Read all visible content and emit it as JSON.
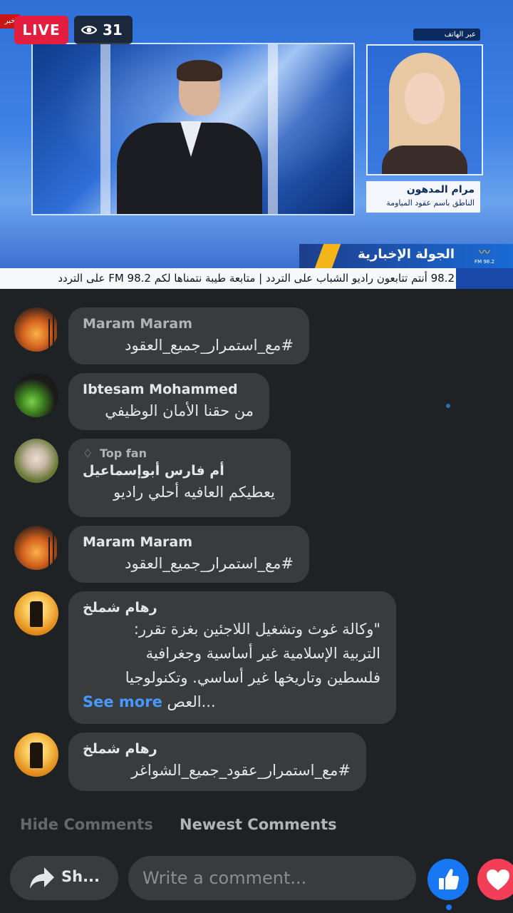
{
  "live": {
    "badge": "LIVE",
    "viewers": "31"
  },
  "video": {
    "corner_tag": "خبر",
    "phone_label": "عبر الهاتف",
    "guest_name": "مرام المدهون",
    "guest_role": "الناطق باسم عقود المياومة",
    "segment_title": "الجولة الإخبارية",
    "ticker": "98.2 أنتم تتابعون راديو الشباب على التردد | متابعة طيبة نتمناها لكم FM 98.2 على التردد",
    "radio_logo": "FM 98.2"
  },
  "comments": [
    {
      "author": "Maram Maram",
      "text": "#مع_استمرار_جميع_العقود",
      "avatar": "sunset-avatar"
    },
    {
      "author": "Ibtesam Mohammed",
      "text": "من حقنا الأمان الوظيفي",
      "avatar": "flowers-avatar"
    },
    {
      "badge": "Top fan",
      "author": "أم فارس أبوإسماعيل",
      "text": "يعطيكم العافيه أحلي راديو",
      "avatar": "man-avatar"
    },
    {
      "author": "Maram Maram",
      "text": "#مع_استمرار_جميع_العقود",
      "avatar": "sunset-avatar"
    },
    {
      "author": "رهام شملخ",
      "lines": [
        "\"وكالة غوث وتشغيل اللاجئين بغزة  تقرر:",
        "التربية الإسلامية غير أساسية وجغرافية",
        "فلسطين وتاريخها غير أساسي. وتكنولوجيا",
        "العص..."
      ],
      "see_more": "See more",
      "avatar": "deer-avatar"
    },
    {
      "author": "رهام شملخ",
      "text": "#مع_استمرار_عقود_جميع_الشواغر",
      "avatar": "deer-avatar"
    }
  ],
  "footer": {
    "hide_comments": "Hide Comments",
    "newest_comments": "Newest Comments",
    "share_label": "Sh...",
    "comment_placeholder": "Write a comment..."
  },
  "colors": {
    "live_red": "#e41e3f",
    "bubble_bg": "#3a3b3c",
    "link_blue": "#4599ff",
    "like_blue": "#1877f2",
    "love_red": "#f33e58"
  }
}
